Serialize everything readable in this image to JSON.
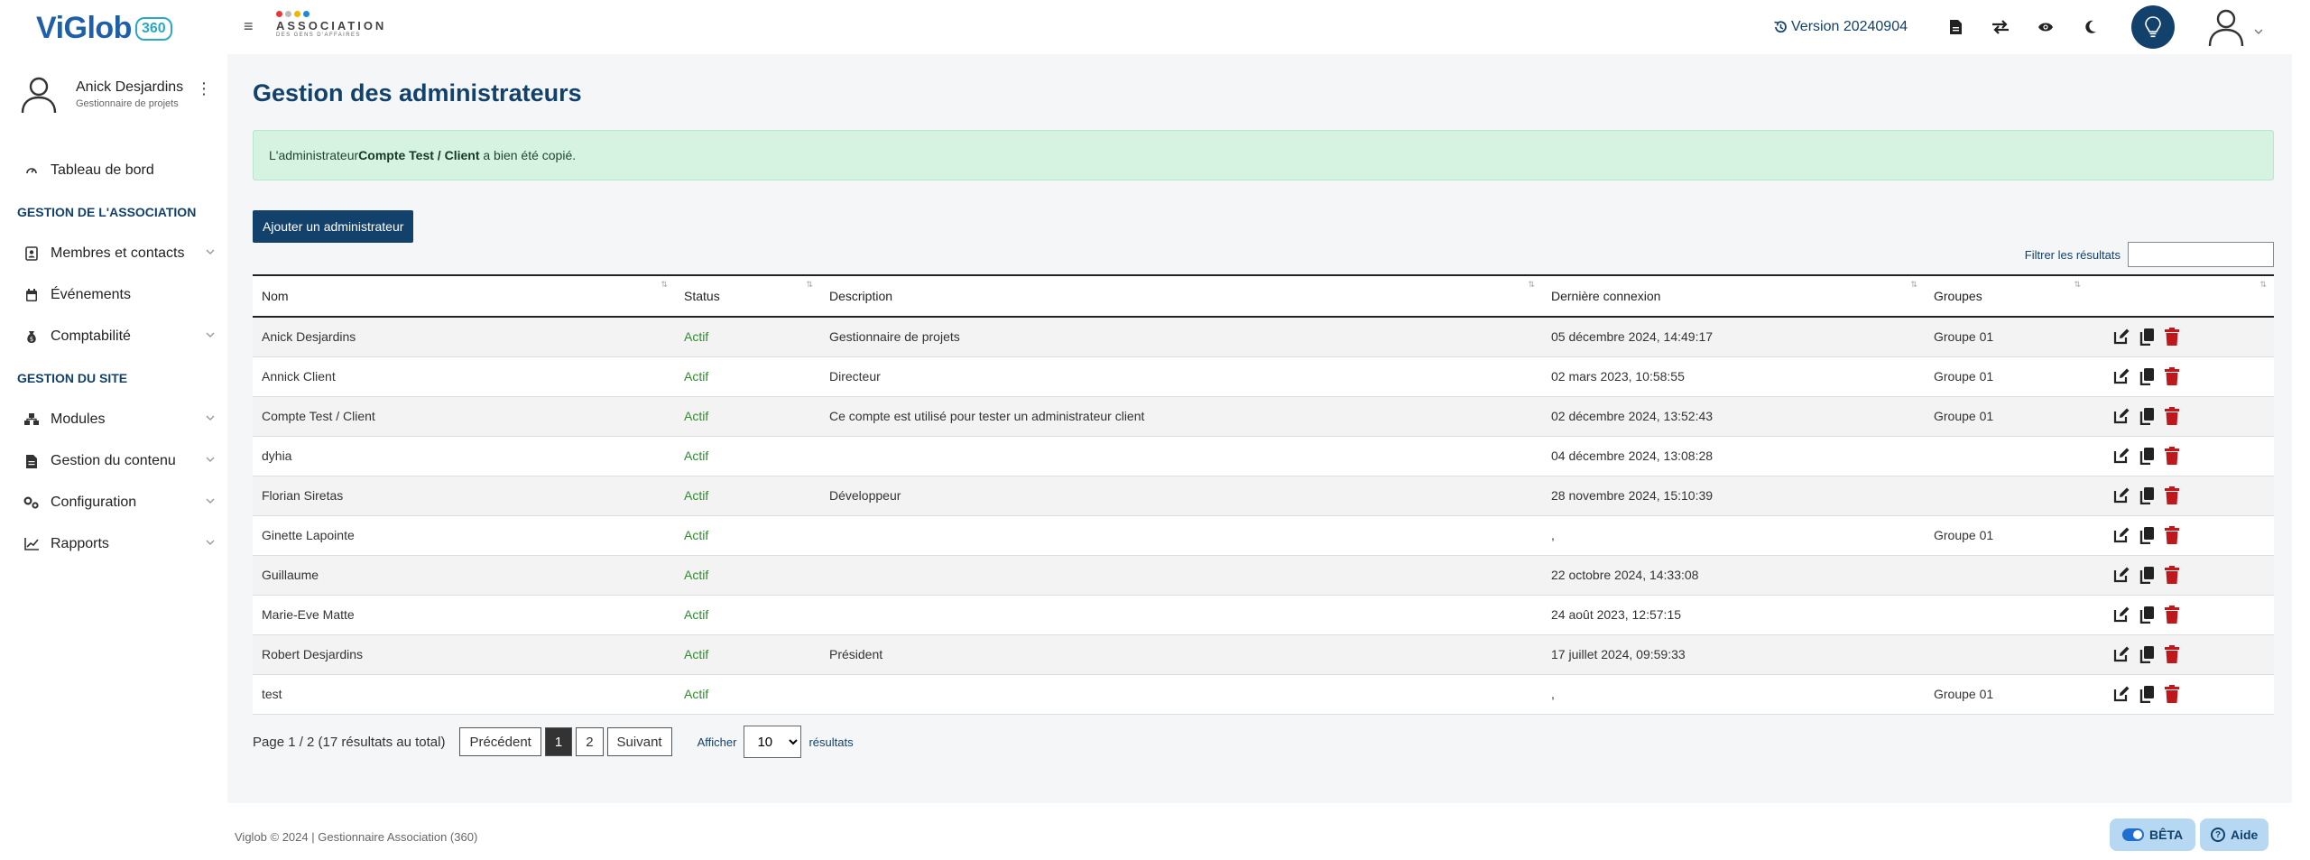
{
  "logo": {
    "text": "ViGlob",
    "badge": "360"
  },
  "assoc_logo": {
    "title": "ASSOCIATION",
    "subtitle": "DES GENS D'AFFAIRES"
  },
  "user": {
    "name": "Anick Desjardins",
    "role": "Gestionnaire de projets"
  },
  "sidebar": {
    "dashboard": "Tableau de bord",
    "section_association": "GESTION DE L'ASSOCIATION",
    "members": "Membres et contacts",
    "events": "Événements",
    "accounting": "Comptabilité",
    "section_site": "GESTION DU SITE",
    "modules": "Modules",
    "content": "Gestion du contenu",
    "configuration": "Configuration",
    "reports": "Rapports"
  },
  "topbar": {
    "version": "Version 20240904"
  },
  "page": {
    "title": "Gestion des administrateurs",
    "alert_prefix": "L'administrateur ",
    "alert_name": "Compte Test / Client",
    "alert_suffix": " a bien été copié.",
    "add_button": "Ajouter un administrateur",
    "filter_label": "Filtrer les résultats",
    "filter_value": ""
  },
  "table": {
    "headers": [
      "Nom",
      "Status",
      "Description",
      "Dernière connexion",
      "Groupes"
    ],
    "rows": [
      {
        "nom": "Anick Desjardins",
        "status": "Actif",
        "description": "Gestionnaire de projets",
        "connexion": "05 décembre 2024, 14:49:17",
        "groupes": "Groupe 01"
      },
      {
        "nom": "Annick Client",
        "status": "Actif",
        "description": "Directeur",
        "connexion": "02 mars 2023, 10:58:55",
        "groupes": "Groupe 01"
      },
      {
        "nom": "Compte Test / Client",
        "status": "Actif",
        "description": "Ce compte est utilisé pour tester un administrateur client",
        "connexion": "02 décembre 2024, 13:52:43",
        "groupes": "Groupe 01"
      },
      {
        "nom": "dyhia",
        "status": "Actif",
        "description": "",
        "connexion": "04 décembre 2024, 13:08:28",
        "groupes": ""
      },
      {
        "nom": "Florian Siretas",
        "status": "Actif",
        "description": "Développeur",
        "connexion": "28 novembre 2024, 15:10:39",
        "groupes": ""
      },
      {
        "nom": "Ginette Lapointe",
        "status": "Actif",
        "description": "",
        "connexion": ",",
        "groupes": "Groupe 01"
      },
      {
        "nom": "Guillaume",
        "status": "Actif",
        "description": "",
        "connexion": "22 octobre 2024, 14:33:08",
        "groupes": ""
      },
      {
        "nom": "Marie-Eve Matte",
        "status": "Actif",
        "description": "",
        "connexion": "24 août 2023, 12:57:15",
        "groupes": ""
      },
      {
        "nom": "Robert Desjardins",
        "status": "Actif",
        "description": "Président",
        "connexion": "17 juillet 2024, 09:59:33",
        "groupes": ""
      },
      {
        "nom": "test",
        "status": "Actif",
        "description": "",
        "connexion": ",",
        "groupes": "Groupe 01"
      }
    ]
  },
  "pager": {
    "info": "Page 1 / 2 (17 résultats au total)",
    "prev": "Précédent",
    "pages": [
      "1",
      "2"
    ],
    "next": "Suivant",
    "show_label": "Afficher",
    "per_page": "10",
    "results_label": "résultats"
  },
  "footer": {
    "text": "Viglob © 2024 | Gestionnaire Association (360)",
    "beta": "BÊTA",
    "help": "Aide"
  },
  "colors": {
    "primary": "#12416b",
    "status_active": "#2e8b2e",
    "delete": "#c0171d",
    "alert_bg": "#d6f2e1"
  },
  "icons": [
    "menu-icon",
    "dashboard-icon",
    "members-icon",
    "calendar-icon",
    "accounting-icon",
    "modules-icon",
    "content-icon",
    "config-icon",
    "reports-icon",
    "history-icon",
    "document-icon",
    "exchange-icon",
    "eye-icon",
    "moon-icon",
    "idea-icon",
    "user-avatar-icon",
    "edit-icon",
    "copy-icon",
    "trash-icon"
  ]
}
